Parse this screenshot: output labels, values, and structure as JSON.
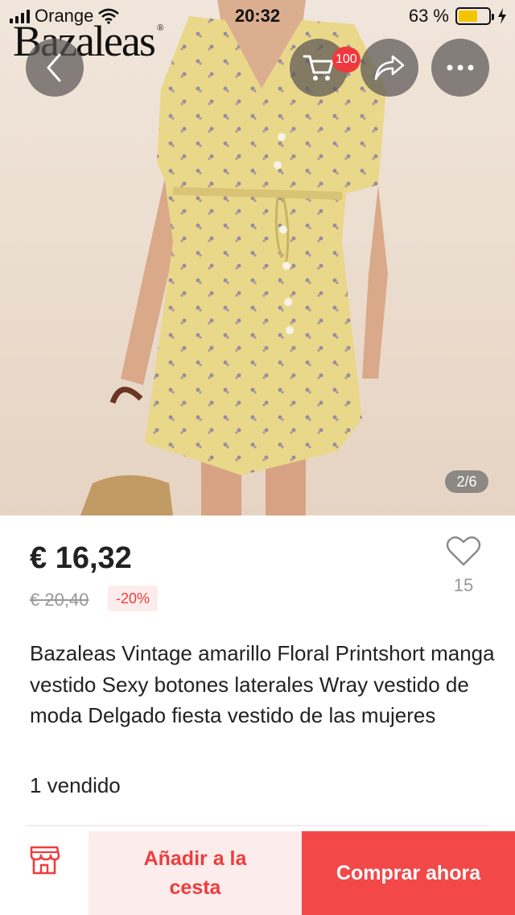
{
  "status_bar": {
    "carrier": "Orange",
    "time": "20:32",
    "battery": "63 %",
    "battery_level": 0.63
  },
  "brand": {
    "name": "Bazaleas",
    "registered": "®"
  },
  "header": {
    "back_icon": "chevron-left-icon",
    "cart_icon": "cart-icon",
    "cart_badge": "100",
    "share_icon": "share-icon",
    "more_icon": "more-icon"
  },
  "gallery": {
    "pager": "2/6"
  },
  "product": {
    "price": "€ 16,32",
    "old_price": "€ 20,40",
    "discount": "-20%",
    "likes": "15",
    "title": "Bazaleas Vintage amarillo Floral Printshort manga vestido Sexy botones laterales Wray vestido de moda Delgado fiesta vestido de las mujeres",
    "sold": "1 vendido"
  },
  "bottom_bar": {
    "store_icon": "store-icon",
    "add_to_cart": "Añadir a la cesta",
    "buy_now": "Comprar ahora"
  },
  "colors": {
    "accent": "#f24848",
    "accent_light": "#fdecec",
    "dress": "#ead88a"
  }
}
